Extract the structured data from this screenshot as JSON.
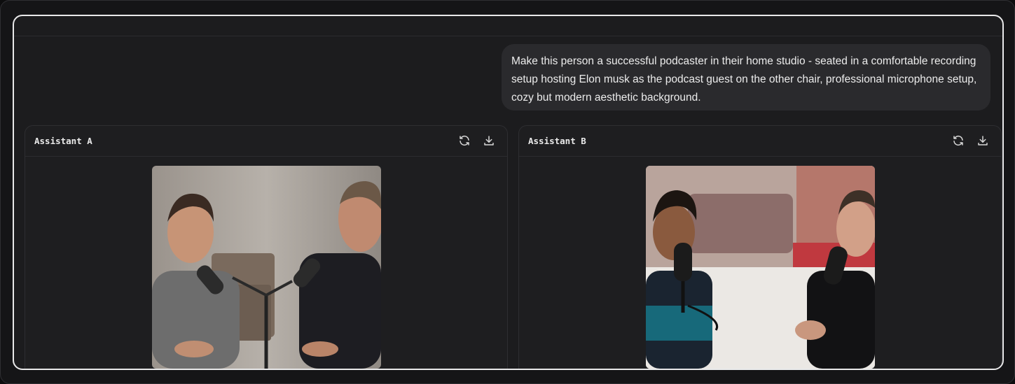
{
  "prompt": {
    "text": "Make this person a successful podcaster in their home studio - seated in a comfortable recording setup hosting Elon musk as the podcast guest on the other chair, professional microphone setup, cozy but modern aesthetic background."
  },
  "panels": [
    {
      "title": "Assistant A",
      "refresh_icon": "refresh-icon",
      "download_icon": "download-icon"
    },
    {
      "title": "Assistant B",
      "refresh_icon": "refresh-icon",
      "download_icon": "download-icon"
    }
  ],
  "colors": {
    "background": "#1c1c1e",
    "bubble": "#2a2a2d",
    "frame_border": "#e9e9ea"
  }
}
